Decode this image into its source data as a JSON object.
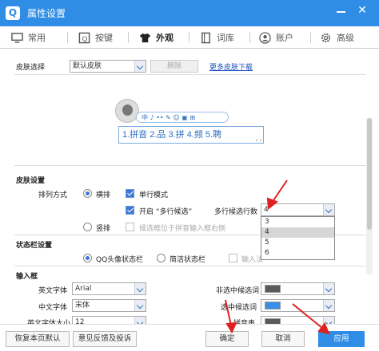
{
  "window": {
    "logo": "Q",
    "title": "属性设置",
    "close_glyph": "✕"
  },
  "tabs": [
    {
      "label": "常用",
      "icon": "monitor-icon"
    },
    {
      "label": "按键",
      "icon": "key-box-icon"
    },
    {
      "label": "外观",
      "icon": "shirt-icon",
      "active": true
    },
    {
      "label": "词库",
      "icon": "book-icon"
    },
    {
      "label": "账户",
      "icon": "user-icon"
    },
    {
      "label": "高级",
      "icon": "gear-icon"
    }
  ],
  "skin": {
    "label": "皮肤选择",
    "selected": "默认皮肤",
    "delete_label": "删除",
    "more_link": "更多皮肤下载"
  },
  "preview": {
    "toolbar_text": "中 ♪ •• ✎ ☺ ▣ ⊞",
    "candidates": "1.拼音 2.品 3.拼 4.频 5.聘",
    "nav": "‹ ›"
  },
  "skin_settings": {
    "heading": "皮肤设置",
    "arrangement_label": "排列方式",
    "horizontal": "横排",
    "vertical": "竖排",
    "single_line": "单行模式",
    "multi_candidate": "开启 “多行候选”",
    "multi_rows_label": "多行候选行数",
    "multi_rows_value": "4",
    "candidate_pos": "候选框位于拼音输入框右侧",
    "rows_options": [
      "3",
      "4",
      "5",
      "6"
    ]
  },
  "status_bar": {
    "heading": "状态栏设置",
    "qq_avatar": "QQ头像状态栏",
    "simple": "简洁状态栏",
    "input_method": "输入法"
  },
  "input_box": {
    "heading": "输入框",
    "en_font_label": "英文字体",
    "en_font": "Arial",
    "cn_font_label": "中文字体",
    "cn_font": "宋体",
    "en_size_label": "英文字体大小",
    "en_size": "12",
    "unselected_label": "非选中候选词",
    "selected_label": "选中候选词",
    "pinyin_label": "拼音串",
    "colors": {
      "unselected": "#5a5a5a",
      "selected": "#3a8ee8",
      "pinyin": "#5a5a5a"
    }
  },
  "footer": {
    "restore": "恢复本页默认",
    "feedback": "意见反馈及投诉",
    "ok": "确定",
    "cancel": "取消",
    "apply": "应用"
  }
}
